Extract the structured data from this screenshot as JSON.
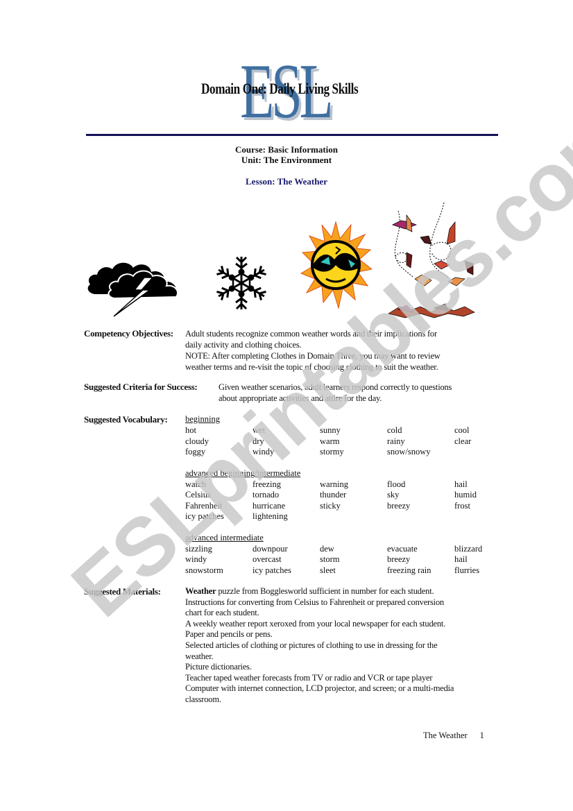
{
  "header": {
    "logo_text": "ESL",
    "domain_title": "Domain One:  Daily Living Skills",
    "rule_color": "#15105a",
    "logo_color": "#3f6fa0"
  },
  "course_info": {
    "course": "Course:  Basic Information",
    "unit": "Unit:  The Environment",
    "lesson": "Lesson:  The Weather",
    "lesson_color": "#1a1a6e"
  },
  "images": [
    {
      "icon": "storm-cloud-lightning-icon",
      "description": "black storm cloud with lightning bolt"
    },
    {
      "icon": "snowflake-icon",
      "description": "black and white snowflake"
    },
    {
      "icon": "sun-with-sunglasses-icon",
      "description": "orange sun wearing sunglasses"
    },
    {
      "icon": "falling-autumn-leaves-icon",
      "description": "autumn leaves blowing in the wind"
    }
  ],
  "sections": {
    "competency": {
      "label": "Competency Objectives:",
      "lines": [
        "Adult students recognize common weather words and their implications  for",
        "daily activity and clothing choices.",
        "NOTE:  After completing Clothes in Domain Three, you may want to review",
        "weather terms and re-visit the topic of choosing clothing to suit the weather."
      ]
    },
    "criteria": {
      "label": "Suggested Criteria for Success:",
      "lines": [
        "Given weather scenarios, adult learners respond correctly to questions",
        "about appropriate activities and attire for the day."
      ]
    },
    "vocabulary": {
      "label": "Suggested Vocabulary:",
      "groups": [
        {
          "heading": "beginning",
          "rows": [
            [
              "hot",
              "wet",
              "sunny",
              "cold",
              "cool"
            ],
            [
              "cloudy",
              "dry",
              "warm",
              "rainy",
              "clear"
            ],
            [
              "foggy",
              "windy",
              "stormy",
              "snow/snowy",
              ""
            ]
          ]
        },
        {
          "heading": "advanced beginning/intermediate",
          "rows": [
            [
              "watch",
              "freezing",
              "warning",
              "flood",
              "hail"
            ],
            [
              "Celsius",
              "tornado",
              "thunder",
              "sky",
              "humid"
            ],
            [
              "Fahrenheit",
              "hurricane",
              "sticky",
              "breezy",
              "frost"
            ],
            [
              "icy patches",
              "lightening",
              "",
              "",
              ""
            ]
          ]
        },
        {
          "heading": "advanced intermediate",
          "rows": [
            [
              "sizzling",
              "downpour",
              "dew",
              "evacuate",
              "blizzard"
            ],
            [
              "windy",
              "overcast",
              "storm",
              "breezy",
              "hail"
            ],
            [
              "snowstorm",
              "icy patches",
              "sleet",
              "freezing rain",
              "flurries"
            ]
          ]
        }
      ]
    },
    "materials": {
      "label": "Suggested Materials:",
      "first_bold": "Weather",
      "first_rest": " puzzle from Bogglesworld sufficient in number for each student.",
      "lines": [
        "Instructions  for converting from Celsius to Fahrenheit or prepared conversion",
        "chart for each student.",
        "A weekly weather report xeroxed from your local newspaper for each student.",
        "Paper and pencils or pens.",
        "Selected articles of clothing or pictures of clothing to use in dressing for the",
        "weather.",
        "Picture dictionaries.",
        "Teacher taped weather forecasts from TV or radio and VCR or tape player",
        "Computer with internet connection, LCD projector, and screen; or a multi-media",
        "classroom."
      ]
    }
  },
  "footer": {
    "title": "The Weather",
    "page_number": "1"
  },
  "watermark": {
    "text": "ESLprintables.com",
    "color": "#c8c8c8"
  }
}
